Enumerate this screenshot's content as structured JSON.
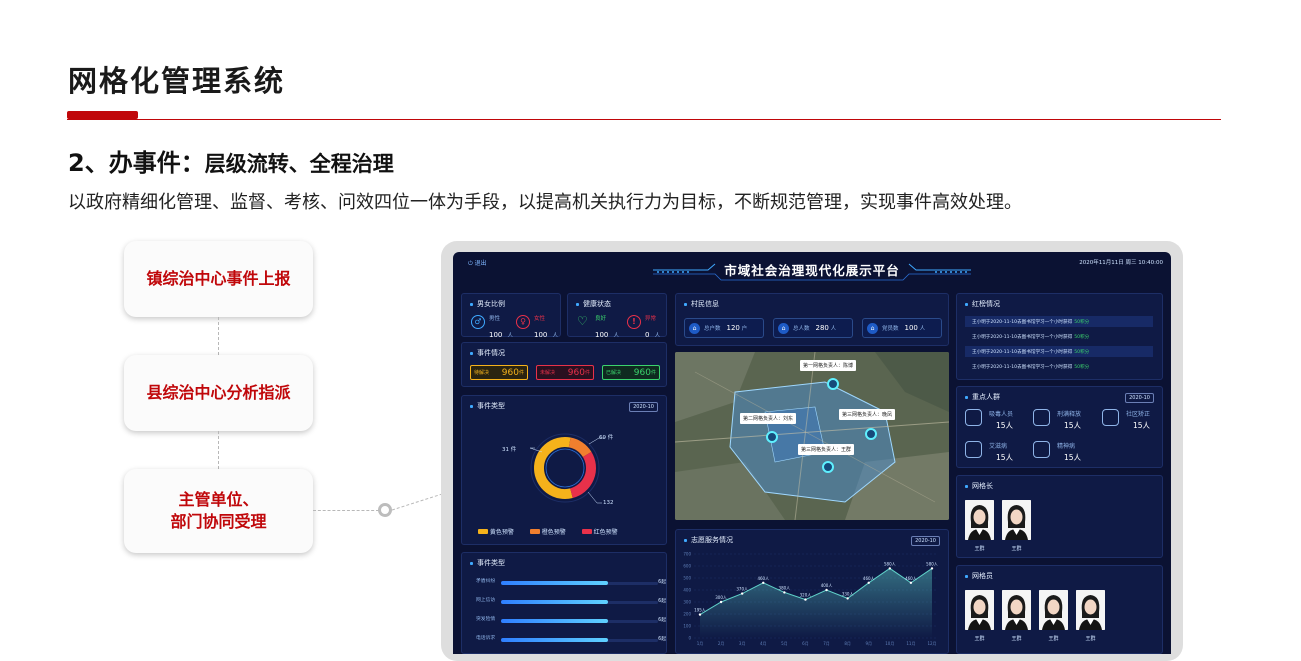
{
  "slide": {
    "title": "网格化管理系统",
    "heading_prefix": "2、办事件：",
    "heading_main": "层级流转、全程治理",
    "description": "以政府精细化管理、监督、考核、问效四位一体为手段，以提高机关执行力为目标，不断规范管理，实现事件高效处理。",
    "accent_color": "#c0070a"
  },
  "process": {
    "step1": "镇综治中心事件上报",
    "step2": "县综治中心分析指派",
    "step3_line1": "主管单位、",
    "step3_line2": "部门协同受理"
  },
  "dashboard": {
    "exit": "退出",
    "title": "市域社会治理现代化展示平台",
    "datetime": "2020年11月11日  周三  10:40:00",
    "gender": {
      "title": "男女比例",
      "male_label": "男性",
      "male_value": "100",
      "male_unit": "人",
      "female_label": "女性",
      "female_value": "100",
      "female_unit": "人"
    },
    "health": {
      "title": "健康状态",
      "good_label": "良好",
      "good_value": "100",
      "good_unit": "人",
      "bad_label": "异常",
      "bad_value": "0",
      "bad_unit": "人"
    },
    "events": {
      "title": "事件情况",
      "pending_label": "待解决",
      "pending_value": "960",
      "pending_unit": "件",
      "unsolved_label": "未解决",
      "unsolved_value": "960",
      "unsolved_unit": "件",
      "solved_label": "已解决",
      "solved_value": "960",
      "solved_unit": "件"
    },
    "event_types": {
      "title": "事件类型",
      "year": "2020-10",
      "label_top": "69 件",
      "label_left": "31 件",
      "label_bottom": "132",
      "legend_yellow": "黄色预警",
      "legend_orange": "橙色预警",
      "legend_red": "红色预警",
      "slices": [
        {
          "name": "黄色预警",
          "value": 132,
          "color": "#f5b21b"
        },
        {
          "name": "橙色预警",
          "value": 31,
          "color": "#f07f2e"
        },
        {
          "name": "红色预警",
          "value": 69,
          "color": "#e8314a"
        }
      ]
    },
    "event_types2": {
      "title": "事件类型",
      "bars": [
        {
          "label": "矛盾纠纷",
          "value": "6起",
          "fraction": 0.68
        },
        {
          "label": "网上信访",
          "value": "6起",
          "fraction": 0.68
        },
        {
          "label": "突发险情",
          "value": "6起",
          "fraction": 0.68
        },
        {
          "label": "电话诉求",
          "value": "6起",
          "fraction": 0.68
        }
      ]
    },
    "villagers": {
      "title": "村民信息",
      "households_label": "总户数",
      "households_value": "120",
      "households_unit": "户",
      "population_label": "总人数",
      "population_value": "280",
      "population_unit": "人",
      "party_label": "党员数",
      "party_value": "100",
      "party_unit": "人"
    },
    "map_labels": {
      "a": "第一网格负责人：陈博",
      "b": "第二网格负责人：刘东",
      "c": "第三网格负责人：晚凤",
      "d": "第三网格负责人：王群"
    },
    "volunteer": {
      "title": "志愿服务情况",
      "year": "2020-10"
    },
    "red_list": {
      "title": "红榜情况",
      "rows": [
        {
          "text": "王小明于2020-11-10去图书馆学习一个小时获得",
          "pts": "50积分"
        },
        {
          "text": "王小明于2020-11-10去图书馆学习一个小时获得",
          "pts": "50积分"
        },
        {
          "text": "王小明于2020-11-10去图书馆学习一个小时获得",
          "pts": "50积分"
        },
        {
          "text": "王小明于2020-11-10去图书馆学习一个小时获得",
          "pts": "50积分"
        }
      ]
    },
    "key_people": {
      "title": "重点人群",
      "year": "2020-10",
      "drug_label": "吸毒人员",
      "drug_value": "15人",
      "release_label": "刑满释放",
      "release_value": "15人",
      "community_label": "社区矫正",
      "community_value": "15人",
      "aids_label": "艾滋病",
      "aids_value": "15人",
      "mental_label": "精神病",
      "mental_value": "15人"
    },
    "grid_leader": {
      "title": "网格长",
      "names": [
        "王群",
        "王群"
      ]
    },
    "grid_staff": {
      "title": "网格员",
      "names": [
        "王群",
        "王群",
        "王群",
        "王群"
      ]
    }
  },
  "chart_data": {
    "type": "line",
    "title": "志愿服务情况",
    "x": [
      "1月",
      "2月",
      "3月",
      "4月",
      "5月",
      "6月",
      "7月",
      "8月",
      "9月",
      "10月",
      "11月",
      "12月"
    ],
    "series": [
      {
        "values": [
          195,
          300,
          370,
          460,
          380,
          320,
          400,
          330,
          460,
          580,
          460,
          580
        ]
      }
    ],
    "data_labels": [
      "195人",
      "300人",
      "370人",
      "460人",
      "380人",
      "320人",
      "400人",
      "330人",
      "460人",
      "580人",
      "460人",
      "580人"
    ],
    "y_ticks": [
      "0",
      "100",
      "200",
      "300",
      "400",
      "500",
      "600",
      "700"
    ],
    "ylim": [
      0,
      700
    ],
    "grid": true,
    "line_color": "#5fd1c9"
  }
}
